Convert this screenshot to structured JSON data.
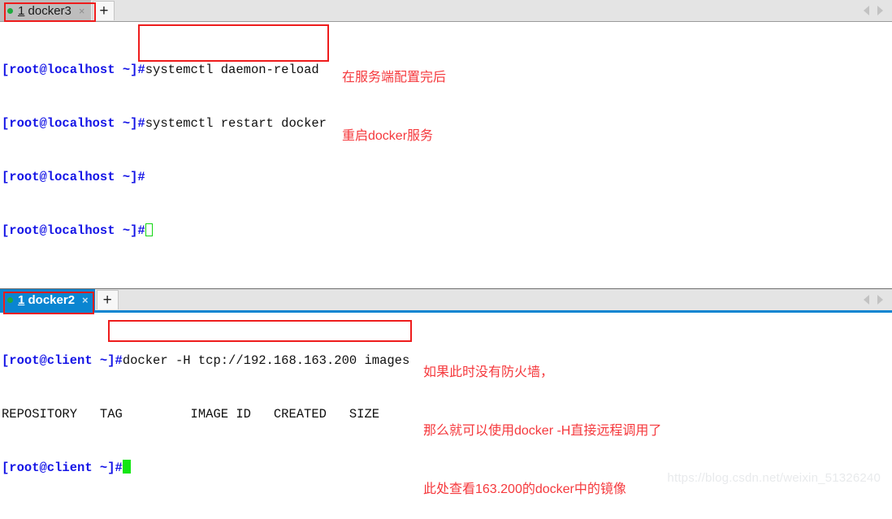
{
  "top_pane": {
    "tabbar": {
      "tab": {
        "status_icon": "green-dot-icon",
        "mnemonic": "1",
        "label": " docker3",
        "close_icon": "×"
      },
      "new_tab_label": "+",
      "scroll_left_icon": "triangle-left-icon",
      "scroll_right_icon": "triangle-right-icon"
    },
    "lines": [
      {
        "prompt": "[root@localhost ~]#",
        "command": "systemctl daemon-reload"
      },
      {
        "prompt": "[root@localhost ~]#",
        "command": "systemctl restart docker"
      },
      {
        "prompt": "[root@localhost ~]#",
        "command": ""
      },
      {
        "prompt": "[root@localhost ~]#",
        "command": ""
      }
    ],
    "annotation": {
      "line1": "在服务端配置完后",
      "line2": "重启docker服务"
    }
  },
  "bottom_pane": {
    "tabbar": {
      "tab": {
        "status_icon": "green-dot-icon",
        "mnemonic": "1",
        "label": " docker2",
        "close_icon": "×"
      },
      "new_tab_label": "+",
      "scroll_left_icon": "triangle-left-icon",
      "scroll_right_icon": "triangle-right-icon"
    },
    "lines": [
      {
        "prompt": "[root@client ~]#",
        "command": "docker -H tcp://192.168.163.200 images"
      },
      {
        "prompt": "",
        "command": "REPOSITORY   TAG         IMAGE ID   CREATED   SIZE"
      },
      {
        "prompt": "[root@client ~]#",
        "command": ""
      }
    ],
    "annotation": {
      "line1": "如果此时没有防火墙，",
      "line2": "那么就可以使用docker -H直接远程调用了",
      "line3": "此处查看163.200的docker中的镜像"
    }
  },
  "watermark": "https://blog.csdn.net/weixin_51326240",
  "colors": {
    "prompt_blue": "#1414e6",
    "annotation_red": "#f5393d",
    "box_red": "#ee1c1c",
    "active_tab_blue": "#0a85d1",
    "cursor_green": "#12e612"
  }
}
